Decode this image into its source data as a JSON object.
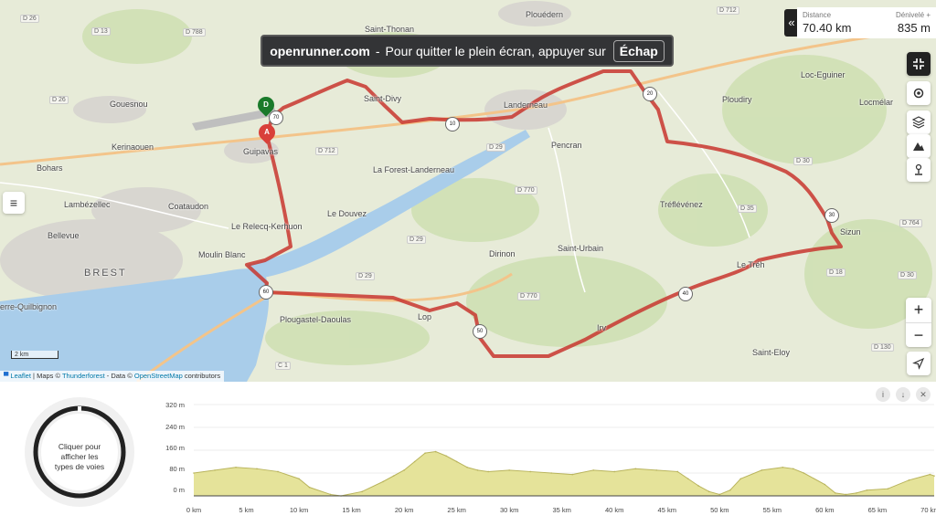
{
  "banner": {
    "site": "openrunner.com",
    "sep": "-",
    "message": "Pour quitter le plein écran, appuyer sur",
    "key": "Échap"
  },
  "stats": {
    "distance_label": "Distance",
    "distance_value": "70.40 km",
    "elevation_label": "Dénivelé +",
    "elevation_value": "835 m"
  },
  "toolbar": {
    "collapse_icon": "«",
    "exit_fullscreen_icon": "compress-icon",
    "settings_icon": "gear-icon",
    "layers_icon": "layers-icon",
    "elevation_icon": "mountain-icon",
    "poi_icon": "person-pin-icon"
  },
  "zoom": {
    "in": "+",
    "out": "−"
  },
  "map": {
    "places": {
      "saint_thonan": "Saint-Thonan",
      "plouedern": "Plouédern",
      "loc_eguiner": "Loc-Eguiner",
      "gouesnou": "Gouesnou",
      "saint_divy": "Saint-Divy",
      "landerneau": "Landerneau",
      "ploudiry": "Ploudiry",
      "locmelar": "Locmélar",
      "kerinaouen": "Kerinaouen",
      "guipavas": "Guipavas",
      "pencran": "Pencran",
      "la_forest": "La Forest-Landerneau",
      "bohars": "Bohars",
      "lambezellec": "Lambézellec",
      "coataudon": "Coataudon",
      "le_douvez": "Le Douvez",
      "trefl": "Tréflévénez",
      "le_relecq": "Le Relecq-Kerhuon",
      "sizun": "Sizun",
      "bellevue": "Bellevue",
      "moulin_blanc": "Moulin Blanc",
      "dirinon": "Dirinon",
      "saint_urbain": "Saint-Urbain",
      "brest": "BREST",
      "le_treh": "Le Tréh",
      "quilbignon": "erre-Quilbignon",
      "plougastel": "Plougastel-Daoulas",
      "lop": "Lop",
      "irvillac": "Irv",
      "saint_eloy": "Saint-Eloy"
    },
    "roads": [
      "D 26",
      "D 13",
      "D 788",
      "D 26",
      "D 712",
      "D 712",
      "D 29",
      "D 770",
      "D 35",
      "D 30",
      "D 764",
      "D 29",
      "D 29",
      "D 770",
      "D 18",
      "D 30",
      "D 130",
      "C 1",
      "D 35"
    ],
    "km_markers": [
      "70",
      "10",
      "20",
      "30",
      "40",
      "50",
      "60"
    ],
    "start_label": "A",
    "finish_label": "D",
    "route_color": "#c8362f",
    "water_color": "#a9cdea",
    "scale_label": "2 km",
    "attribution": {
      "leaflet": "Leaflet",
      "maps": " | Maps © ",
      "thunderforest": "Thunderforest",
      "data": " - Data © ",
      "osm": "OpenStreetMap",
      "contrib": " contributors"
    }
  },
  "menu_icon": "hamburger-icon",
  "profile": {
    "donut_text": "Cliquer pour afficher les types de voies",
    "info_icon": "i",
    "download_icon": "↓",
    "close_icon": "✕",
    "y_ticks": [
      "320 m",
      "240 m",
      "160 m",
      "80 m",
      "0 m"
    ],
    "x_ticks": [
      "0 km",
      "5 km",
      "10 km",
      "15 km",
      "20 km",
      "25 km",
      "30 km",
      "35 km",
      "40 km",
      "45 km",
      "50 km",
      "55 km",
      "60 km",
      "65 km",
      "70 km"
    ]
  },
  "chart_data": {
    "type": "area",
    "xlabel": "",
    "ylabel": "",
    "xlim": [
      0,
      70.4
    ],
    "ylim": [
      0,
      320
    ],
    "x": [
      0,
      2,
      4,
      6,
      8,
      10,
      11,
      13,
      14,
      16,
      18,
      19,
      20,
      21,
      22,
      23,
      24,
      25,
      26,
      27,
      28,
      30,
      32,
      34,
      36,
      38,
      40,
      42,
      44,
      46,
      47,
      48,
      49,
      50,
      51,
      52,
      54,
      56,
      57,
      58,
      60,
      61,
      62,
      63,
      64,
      66,
      68,
      70,
      70.4
    ],
    "y": [
      80,
      90,
      100,
      95,
      85,
      60,
      30,
      5,
      0,
      15,
      50,
      70,
      90,
      120,
      150,
      155,
      140,
      120,
      100,
      90,
      85,
      90,
      85,
      80,
      75,
      90,
      85,
      95,
      90,
      85,
      60,
      35,
      15,
      5,
      20,
      60,
      90,
      100,
      95,
      80,
      40,
      10,
      5,
      10,
      20,
      25,
      55,
      75,
      70
    ],
    "fill_color": "#e5e39a",
    "line_color": "#b9b45c"
  }
}
